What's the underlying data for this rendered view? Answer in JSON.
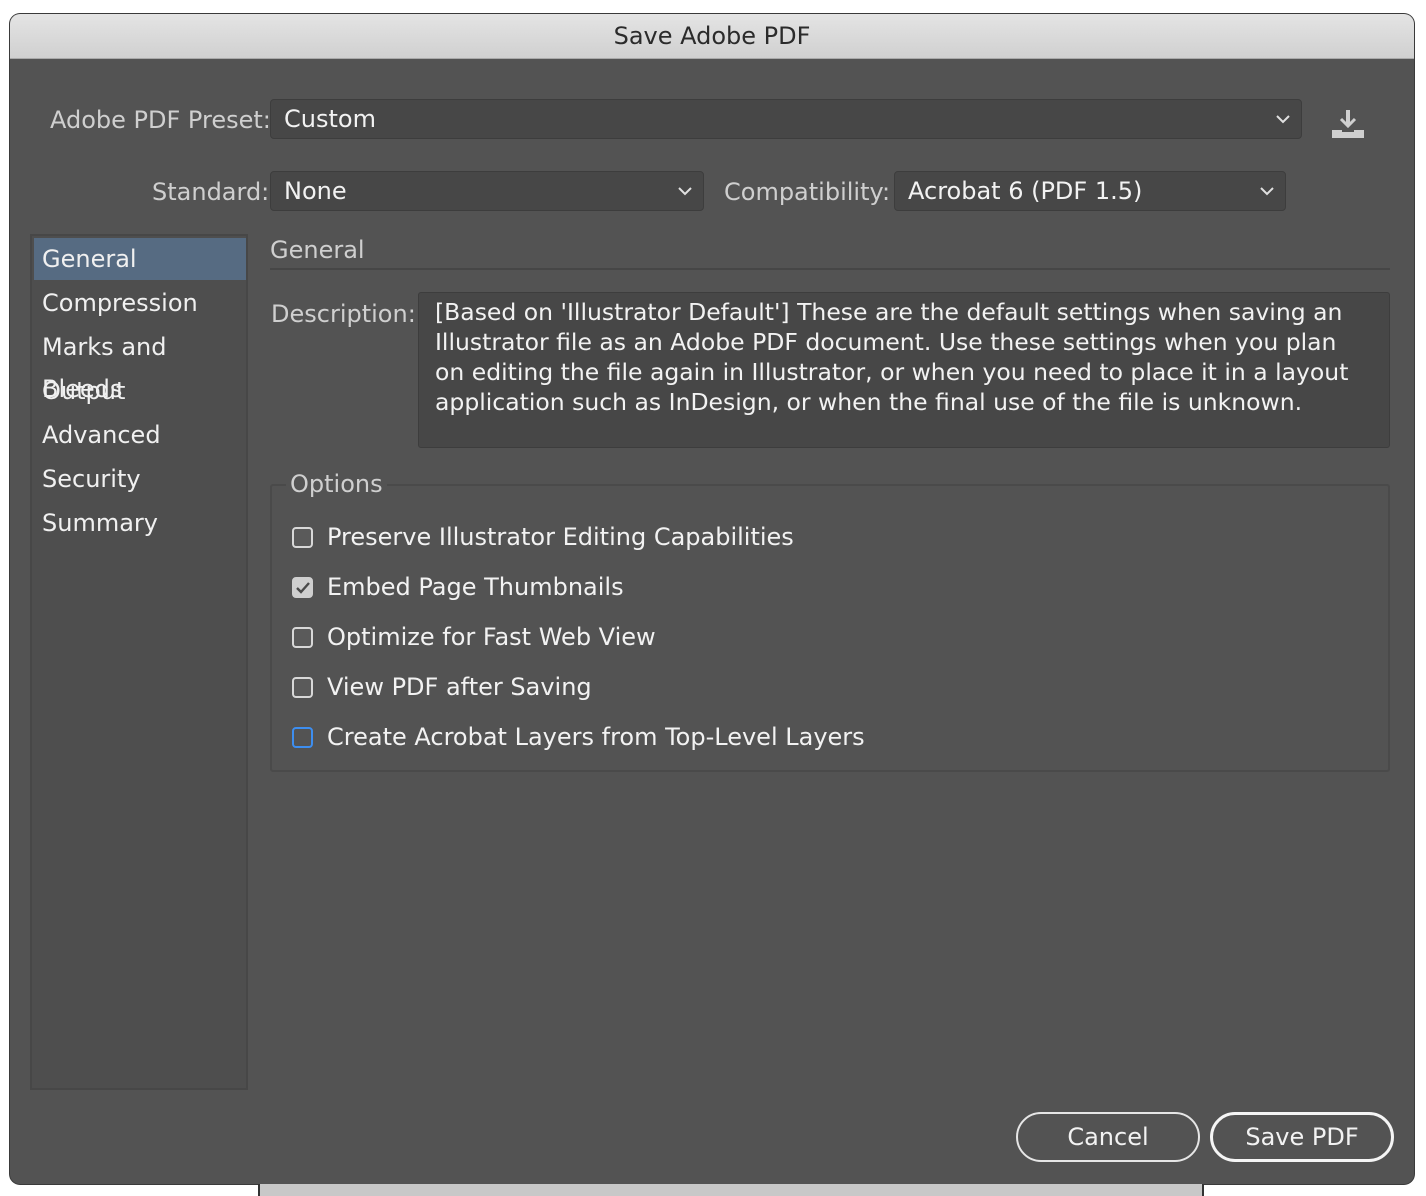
{
  "window": {
    "title": "Save Adobe PDF"
  },
  "preset": {
    "label": "Adobe PDF Preset:",
    "value": "Custom",
    "save_icon": "save-preset-download-icon"
  },
  "standard": {
    "label": "Standard:",
    "value": "None"
  },
  "compatibility": {
    "label": "Compatibility:",
    "value": "Acrobat 6 (PDF 1.5)"
  },
  "sidebar": {
    "items": [
      {
        "label": "General",
        "active": true
      },
      {
        "label": "Compression",
        "active": false
      },
      {
        "label": "Marks and Bleeds",
        "active": false
      },
      {
        "label": "Output",
        "active": false
      },
      {
        "label": "Advanced",
        "active": false
      },
      {
        "label": "Security",
        "active": false
      },
      {
        "label": "Summary",
        "active": false
      }
    ]
  },
  "general": {
    "title": "General",
    "description_label": "Description:",
    "description": "[Based on 'Illustrator Default'] These are the default settings when saving an Illustrator file as an Adobe PDF document. Use these settings when you plan on editing the file again in Illustrator, or when you need to place it in a layout application such as InDesign, or when the final use of the file is unknown."
  },
  "options": {
    "title": "Options",
    "items": [
      {
        "label": "Preserve Illustrator Editing Capabilities",
        "checked": false
      },
      {
        "label": "Embed Page Thumbnails",
        "checked": true
      },
      {
        "label": "Optimize for Fast Web View",
        "checked": false
      },
      {
        "label": "View PDF after Saving",
        "checked": false
      },
      {
        "label": "Create Acrobat Layers from Top-Level Layers",
        "checked": false,
        "focused": true
      }
    ]
  },
  "buttons": {
    "cancel": "Cancel",
    "save": "Save PDF"
  },
  "colors": {
    "background": "#535353",
    "selection": "#566b82",
    "focus_ring": "#3d8ef0"
  }
}
